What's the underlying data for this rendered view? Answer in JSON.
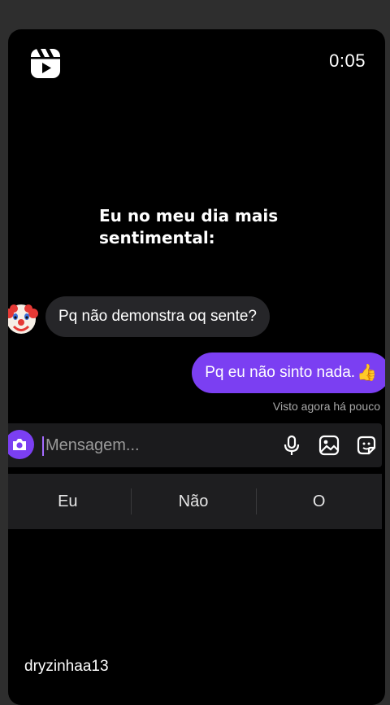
{
  "video": {
    "timer": "0:05",
    "caption_line1": "Eu no meu dia mais",
    "caption_line2": "sentimental:",
    "username": "dryzinhaa13"
  },
  "chat": {
    "incoming_text": "Pq não demonstra oq sente?",
    "outgoing_text": "Pq eu não sinto nada.",
    "outgoing_emoji": "👍",
    "seen_status": "Visto agora há pouco",
    "avatar_icon": "clown-face-icon",
    "accent_color": "#7b3ff2"
  },
  "composer": {
    "placeholder": "Mensagem..."
  },
  "keyboard": {
    "suggestions": [
      "Eu",
      "Não",
      "O"
    ]
  }
}
